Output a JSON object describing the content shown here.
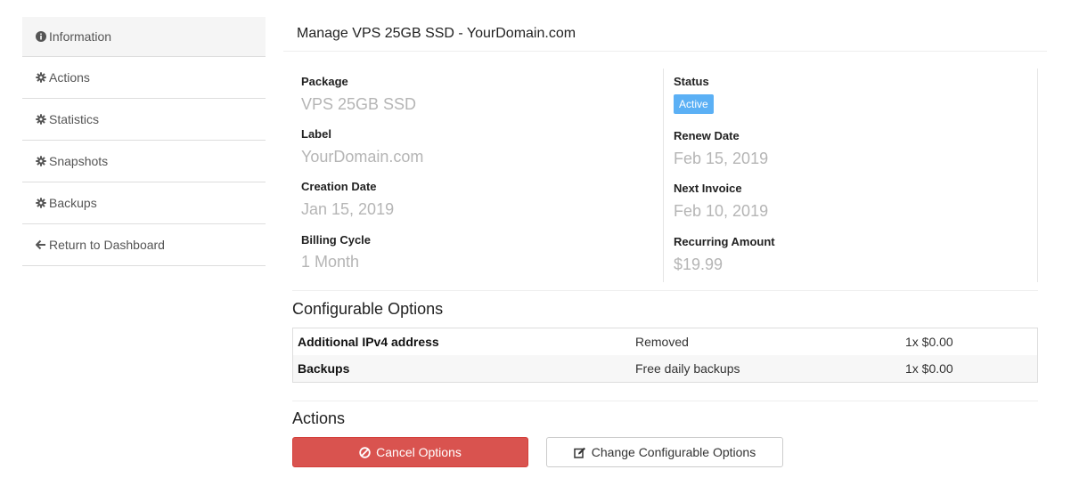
{
  "sidebar": {
    "items": [
      {
        "label": "Information",
        "icon": "info-circle-icon"
      },
      {
        "label": "Actions",
        "icon": "gear-icon"
      },
      {
        "label": "Statistics",
        "icon": "gear-icon"
      },
      {
        "label": "Snapshots",
        "icon": "gear-icon"
      },
      {
        "label": "Backups",
        "icon": "gear-icon"
      },
      {
        "label": "Return to Dashboard",
        "icon": "arrow-left-icon"
      }
    ]
  },
  "main": {
    "title": "Manage VPS 25GB SSD - YourDomain.com",
    "details": {
      "package_label": "Package",
      "package_value": "VPS 25GB SSD",
      "label_label": "Label",
      "label_value": "YourDomain.com",
      "creation_label": "Creation Date",
      "creation_value": "Jan 15, 2019",
      "billing_label": "Billing Cycle",
      "billing_value": "1 Month",
      "status_label": "Status",
      "status_value": "Active",
      "renew_label": "Renew Date",
      "renew_value": "Feb 15, 2019",
      "invoice_label": "Next Invoice",
      "invoice_value": "Feb 10, 2019",
      "recurring_label": "Recurring Amount",
      "recurring_value": "$19.99"
    },
    "configurable": {
      "title": "Configurable Options",
      "rows": [
        {
          "name": "Additional IPv4 address",
          "value": "Removed",
          "price": "1x $0.00"
        },
        {
          "name": "Backups",
          "value": "Free daily backups",
          "price": "1x $0.00"
        }
      ]
    },
    "actions": {
      "title": "Actions",
      "cancel_label": "Cancel Options",
      "change_label": "Change Configurable Options"
    }
  },
  "colors": {
    "active_badge": "#5bb0f5",
    "cancel_button": "#d9534f"
  }
}
